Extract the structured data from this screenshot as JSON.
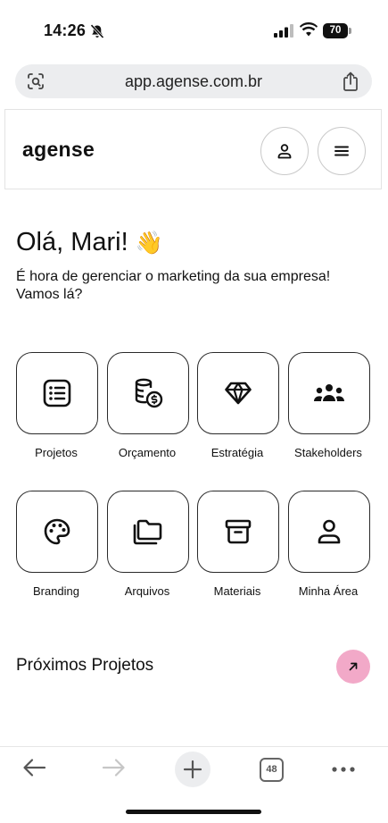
{
  "status_bar": {
    "time": "14:26",
    "battery": "70"
  },
  "browser": {
    "url": "app.agense.com.br",
    "tab_count": "48"
  },
  "header": {
    "logo": "agense"
  },
  "greeting": {
    "title": "Olá, Mari!",
    "emoji": "👋",
    "subtitle": "É hora de gerenciar o marketing da sua empresa! Vamos lá?"
  },
  "tiles": [
    {
      "label": "Projetos",
      "icon": "list-icon"
    },
    {
      "label": "Orçamento",
      "icon": "coins-icon"
    },
    {
      "label": "Estratégia",
      "icon": "diamond-icon"
    },
    {
      "label": "Stakeholders",
      "icon": "group-icon"
    },
    {
      "label": "Branding",
      "icon": "palette-icon"
    },
    {
      "label": "Arquivos",
      "icon": "folders-icon"
    },
    {
      "label": "Materiais",
      "icon": "archive-icon"
    },
    {
      "label": "Minha Área",
      "icon": "user-icon"
    }
  ],
  "next_projects": {
    "title": "Próximos Projetos"
  },
  "colors": {
    "accent_pink": "#f2a9c8",
    "url_bar_bg": "#ecedef"
  }
}
